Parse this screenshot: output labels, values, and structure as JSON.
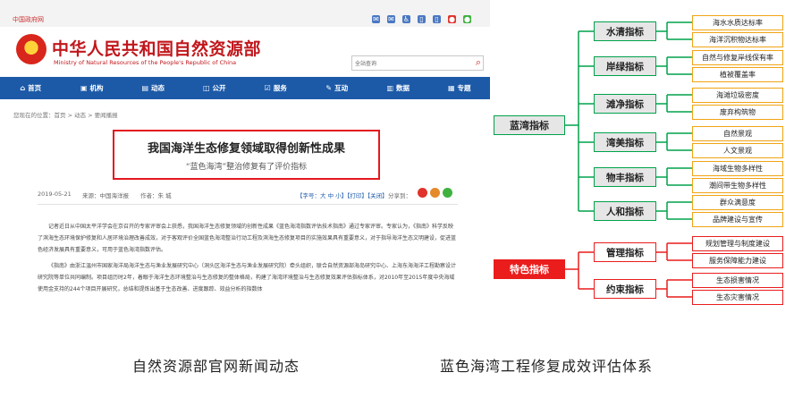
{
  "site": {
    "gov_link": "中国政府网",
    "top_icons": [
      {
        "icon": "mail-icon",
        "color": "#4a78c2"
      },
      {
        "icon": "mail-icon",
        "color": "#4a78c2"
      },
      {
        "icon": "accessibility-icon",
        "color": "#4a78c2"
      },
      {
        "icon": "app-icon",
        "color": "#4a78c2"
      },
      {
        "icon": "mobile-icon",
        "color": "#4a78c2"
      },
      {
        "icon": "weibo-icon",
        "color": "#e0332b"
      },
      {
        "icon": "wechat-icon",
        "color": "#3fb13f"
      }
    ],
    "ministry_cn": "中华人民共和国自然资源部",
    "ministry_en": "Ministry of Natural Resources of the People's Republic of China",
    "search": {
      "scope": "全站查询"
    },
    "nav": [
      {
        "label": "首页",
        "icon": "home-icon",
        "glyph": "⌂"
      },
      {
        "label": "机构",
        "icon": "org-icon",
        "glyph": "▣"
      },
      {
        "label": "动态",
        "icon": "news-icon",
        "glyph": "▤"
      },
      {
        "label": "公开",
        "icon": "open-icon",
        "glyph": "◫"
      },
      {
        "label": "服务",
        "icon": "service-icon",
        "glyph": "☑"
      },
      {
        "label": "互动",
        "icon": "interact-icon",
        "glyph": "✎"
      },
      {
        "label": "数据",
        "icon": "data-icon",
        "glyph": "▥"
      },
      {
        "label": "专题",
        "icon": "topic-icon",
        "glyph": "▦"
      }
    ],
    "breadcrumb": "您现在的位置：首页 > 动态 > 要闻播报",
    "article": {
      "title": "我国海洋生态修复领域取得创新性成果",
      "subtitle": "“蓝色海湾”整治修复有了评价指标",
      "date": "2019-05-21",
      "source": "来源：中国海洋报",
      "author": "作者：朱 城",
      "tools": "【字号：大 中 小】【打印】【关闭】",
      "share": "分享到：",
      "para1": "记者近日从中国太平洋学会在京召开的专家评审会上获悉，我国海洋生态修复领域的创新性成果《蓝色海湾指数评估技术指南》通过专家评审。专家认为，《指南》科学反映了滨海生态环境保护修复和人居环境治理改善成效，对于客观评价全国蓝色海湾整治行动工程及滨海生态修复项目的实施效果具有重要意义，对于指导海洋生态文明建设，促进蓝色经济发展具有重要意义，可用于蓝色海湾指数评估。",
      "para2": "《指南》由浙江温州市国家海洋局海洋生态与渔业发展研究中心（洞头区海洋生态与渔业发展研究院）牵头组织，联合自然资源部海岛研究中心、上海东海海洋工程勘察设计研究院等单位共同编制。项目组历时2年，着眼于海洋生态环境整治与生态修复的整体格局，构建了海湾环境整治与生态修复效果评估指标体系，对2010年至2015年度中央海域使用金支持的244个项目开展研究，总结和提炼出基于生态改善、进度跟踪、效益分析的指数体"
    }
  },
  "mindmap": {
    "groups": [
      {
        "root": "蓝湾指标",
        "red": false,
        "children": [
          {
            "label": "水清指标",
            "leaves": [
              "海水水质达标率",
              "海洋沉积物达标率"
            ]
          },
          {
            "label": "岸绿指标",
            "leaves": [
              "自然与修复岸线保有率",
              "植被覆盖率"
            ]
          },
          {
            "label": "滩净指标",
            "leaves": [
              "海滩垃圾密度",
              "废弃构筑物"
            ]
          },
          {
            "label": "湾美指标",
            "leaves": [
              "自然景观",
              "人文景观"
            ]
          },
          {
            "label": "物丰指标",
            "leaves": [
              "海域生物多样性",
              "潮间带生物多样性"
            ]
          },
          {
            "label": "人和指标",
            "leaves": [
              "群众满意度",
              "品牌建设与宣传"
            ]
          }
        ]
      },
      {
        "root": "特色指标",
        "red": true,
        "children": [
          {
            "label": "管理指标",
            "leaves": [
              "规划管理与制度建设",
              "服务保障能力建设"
            ]
          },
          {
            "label": "约束指标",
            "leaves": [
              "生态损害情况",
              "生态灾害情况"
            ]
          }
        ]
      }
    ]
  },
  "captions": {
    "left": "自然资源部官网新闻动态",
    "right": "蓝色海湾工程修复成效评估体系"
  }
}
